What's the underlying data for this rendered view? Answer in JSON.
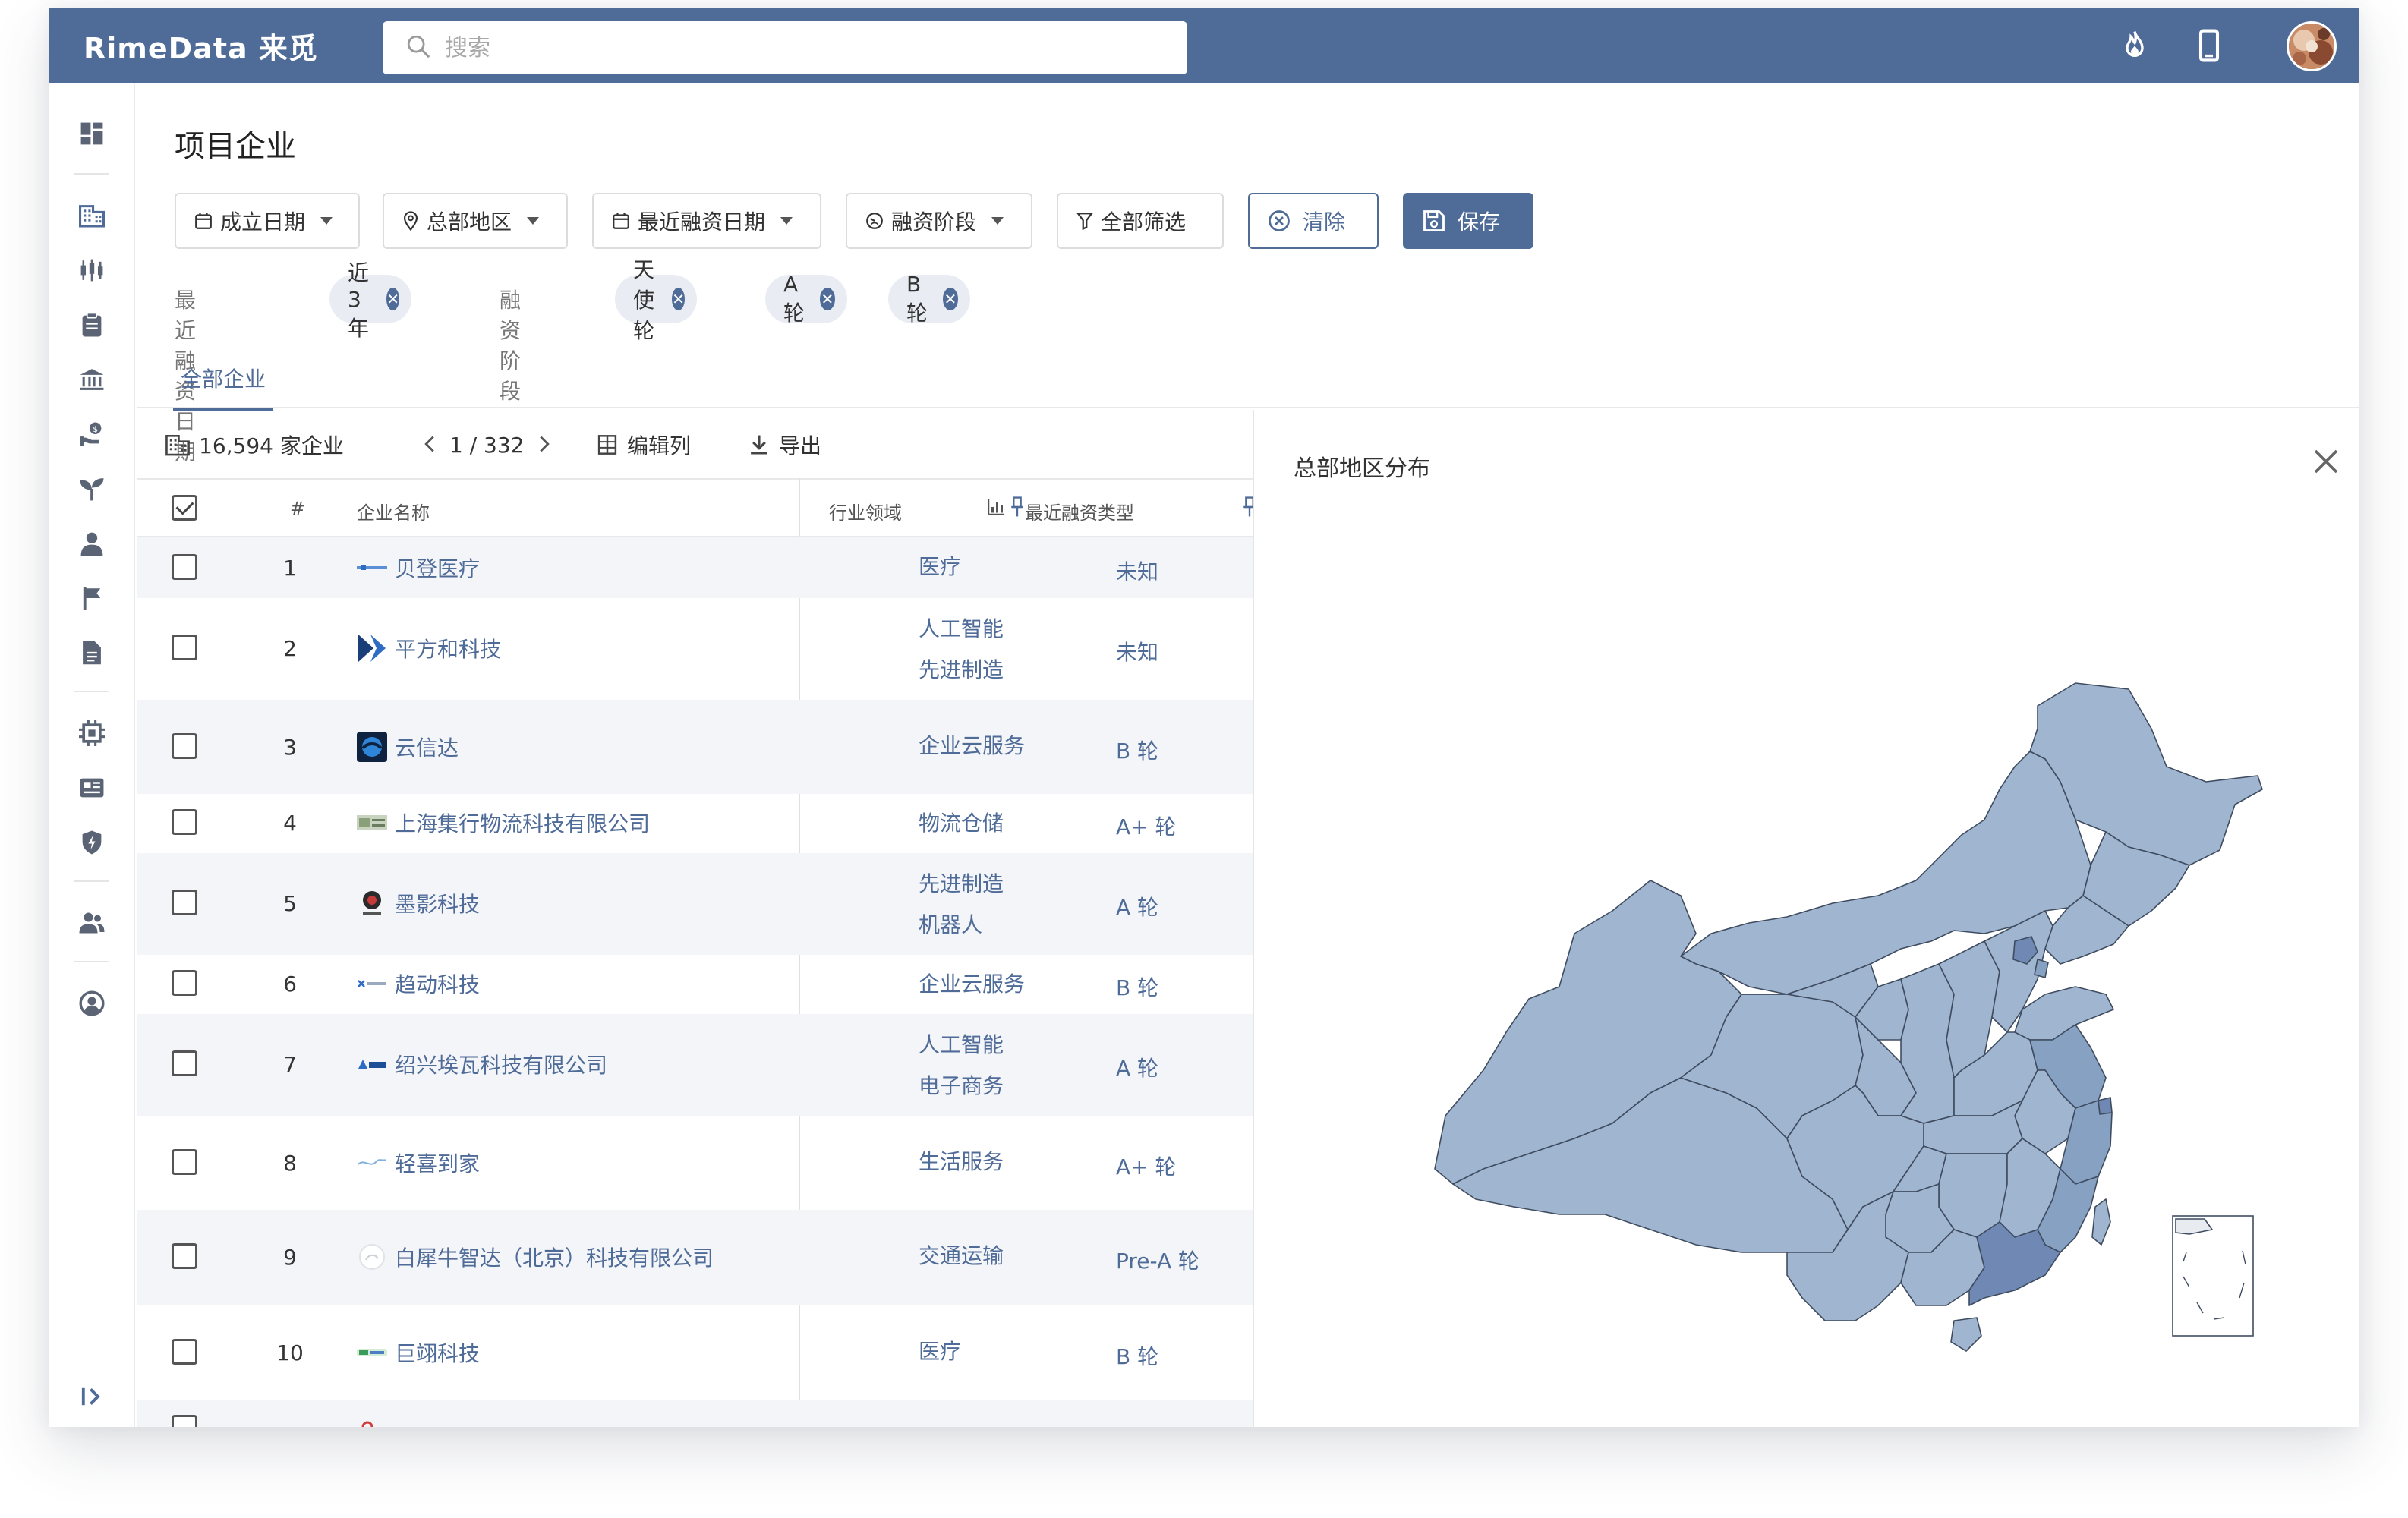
{
  "brand": {
    "logo": "RimeData 来觅"
  },
  "header": {
    "search_placeholder": "搜索",
    "icons": [
      "fire-icon",
      "mobile-icon",
      "avatar"
    ]
  },
  "sidebar": {
    "icons": [
      "dashboard-icon",
      "building-icon",
      "candlestick-icon",
      "clipboard-icon",
      "bank-icon",
      "money-user-icon",
      "sprout-icon",
      "person-icon",
      "flag-icon",
      "document-icon",
      "chip-icon",
      "news-icon",
      "shield-icon",
      "team-icon",
      "account-icon",
      "expand-icon"
    ]
  },
  "page": {
    "title": "项目企业"
  },
  "filters": {
    "found_date": "成立日期",
    "hq_region": "总部地区",
    "recent_funding_date": "最近融资日期",
    "funding_stage": "融资阶段",
    "all_filters": "全部筛选",
    "clear": "清除",
    "save": "保存"
  },
  "active_filters": {
    "recent_funding_label": "最近融资日期",
    "recent_funding_tag": "近 3 年",
    "stage_label": "融资阶段",
    "stage_tags": [
      "天使轮",
      "A 轮",
      "B 轮"
    ]
  },
  "tabs": {
    "active": "全部企业"
  },
  "table": {
    "count_text": "16,594 家企业",
    "pagination": "1 / 332",
    "edit_columns": "编辑列",
    "export": "导出",
    "headers": {
      "index": "#",
      "name": "企业名称",
      "industry": "行业领域",
      "funding_type": "最近融资类型"
    },
    "rows": [
      {
        "index": "1",
        "name": "贝登医疗",
        "industry": [
          "医疗"
        ],
        "funding": "未知"
      },
      {
        "index": "2",
        "name": "平方和科技",
        "industry": [
          "人工智能",
          "先进制造"
        ],
        "funding": "未知"
      },
      {
        "index": "3",
        "name": "云信达",
        "industry": [
          "企业云服务"
        ],
        "funding": "B 轮"
      },
      {
        "index": "4",
        "name": "上海集行物流科技有限公司",
        "industry": [
          "物流仓储"
        ],
        "funding": "A+ 轮"
      },
      {
        "index": "5",
        "name": "墨影科技",
        "industry": [
          "先进制造",
          "机器人"
        ],
        "funding": "A 轮"
      },
      {
        "index": "6",
        "name": "趋动科技",
        "industry": [
          "企业云服务"
        ],
        "funding": "B 轮"
      },
      {
        "index": "7",
        "name": "绍兴埃瓦科技有限公司",
        "industry": [
          "人工智能",
          "电子商务"
        ],
        "funding": "A 轮"
      },
      {
        "index": "8",
        "name": "轻喜到家",
        "industry": [
          "生活服务"
        ],
        "funding": "A+ 轮"
      },
      {
        "index": "9",
        "name": "白犀牛智达（北京）科技有限公司",
        "industry": [
          "交通运输"
        ],
        "funding": "Pre-A 轮"
      },
      {
        "index": "10",
        "name": "巨翊科技",
        "industry": [
          "医疗"
        ],
        "funding": "B 轮"
      }
    ]
  },
  "map_panel": {
    "title": "总部地区分布",
    "colors": {
      "base": "#9fb5d0",
      "mid": "#87a1c3",
      "high": "#6f89b4",
      "border": "#3f4c60"
    }
  },
  "theme": {
    "primary": "#4f6b98",
    "tag_bg": "#e9edf3",
    "row_alt": "#f3f5f8"
  }
}
